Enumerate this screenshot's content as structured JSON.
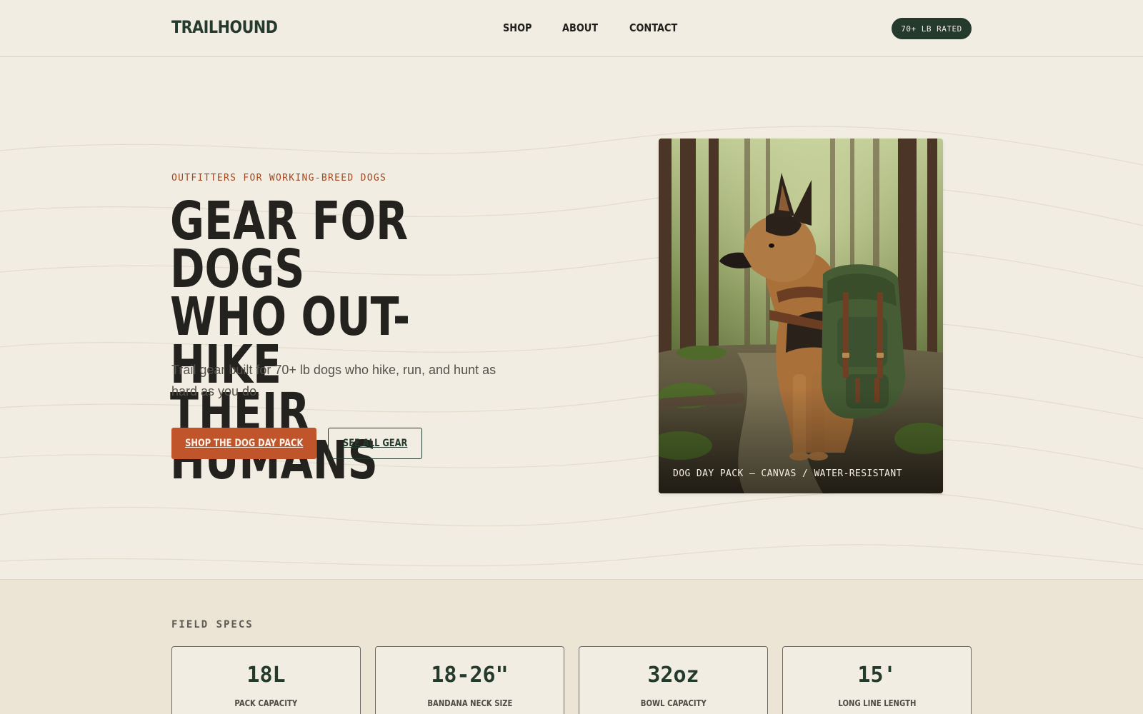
{
  "header": {
    "logo": "TRAILHOUND",
    "nav": [
      "SHOP",
      "ABOUT",
      "CONTACT"
    ],
    "badge": "70+ LB RATED"
  },
  "hero": {
    "eyebrow": "OUTFITTERS FOR WORKING-BREED DOGS",
    "headline_lines": [
      "GEAR FOR DOGS",
      "WHO OUT-HIKE",
      "THEIR HUMANS"
    ],
    "subcopy": "Trail gear built for 70+ lb dogs who hike, run, and hunt as hard as you do.",
    "primary_cta": "SHOP THE DOG DAY PACK",
    "secondary_cta": "SEE ALL GEAR",
    "image_caption": "DOG DAY PACK — CANVAS / WATER-RESISTANT"
  },
  "specs": {
    "title": "FIELD SPECS",
    "cards": [
      {
        "value": "18L",
        "label": "PACK CAPACITY"
      },
      {
        "value": "18-26\"",
        "label": "BANDANA NECK SIZE"
      },
      {
        "value": "32oz",
        "label": "BOWL CAPACITY"
      },
      {
        "value": "15'",
        "label": "LONG LINE LENGTH"
      }
    ]
  },
  "colors": {
    "background": "#f2ede2",
    "brand_green": "#233a2d",
    "accent_rust": "#c0552c",
    "eyebrow_rust": "#a4481f",
    "specs_background": "#ece4d4"
  }
}
